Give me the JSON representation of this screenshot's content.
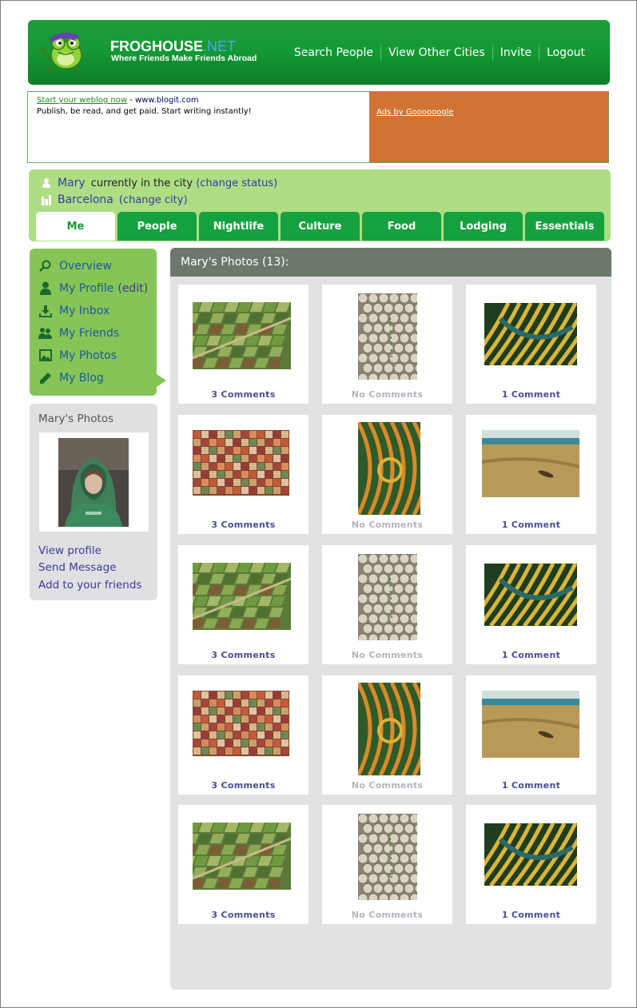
{
  "header": {
    "brand_main": "FROGHOUSE",
    "brand_dot": ".",
    "brand_net": "NET",
    "tagline": "Where Friends Make Friends Abroad",
    "nav": [
      "Search People",
      "View Other Cities",
      "Invite",
      "Logout"
    ]
  },
  "ad": {
    "title": "Start your weblog now",
    "separator": " - ",
    "url": "www.blogit.com",
    "body": "Publish, be read, and get paid. Start writing instantly!",
    "ads_by": "Ads by Goooooogle"
  },
  "status": {
    "name": "Mary",
    "text": "currently in the city",
    "change_status": "(change status)",
    "city": "Barcelona",
    "change_city": "(change city)"
  },
  "tabs": [
    "Me",
    "People",
    "Nightlife",
    "Culture",
    "Food",
    "Lodging",
    "Essentials"
  ],
  "menu": {
    "overview": "Overview",
    "profile": "My Profile",
    "profile_edit": "(edit)",
    "inbox": "My Inbox",
    "friends": "My Friends",
    "photos": "My Photos",
    "blog": "My Blog"
  },
  "profile_box": {
    "title": "Mary's Photos",
    "view_profile": "View profile",
    "send_message": "Send Message",
    "add_friends": "Add to your friends"
  },
  "photos_panel": {
    "title": "Mary's Photos (13):",
    "photos": [
      {
        "comments": "3 Comments"
      },
      {
        "comments": "No Comments"
      },
      {
        "comments": "1 Comment"
      },
      {
        "comments": "3 Comments"
      },
      {
        "comments": "No Comments"
      },
      {
        "comments": "1 Comment"
      },
      {
        "comments": "3 Comments"
      },
      {
        "comments": "No Comments"
      },
      {
        "comments": "1 Comment"
      },
      {
        "comments": "3 Comments"
      },
      {
        "comments": "No Comments"
      },
      {
        "comments": "1 Comment"
      },
      {
        "comments": "3 Comments"
      },
      {
        "comments": "No Comments"
      },
      {
        "comments": "1 Comment"
      }
    ]
  },
  "colors": {
    "header_green": "#159a36",
    "status_green": "#aedd84",
    "menu_green": "#86c456",
    "ad_orange": "#d07333",
    "link_purple": "#3a3a9a",
    "panel_head": "#6c786c"
  }
}
